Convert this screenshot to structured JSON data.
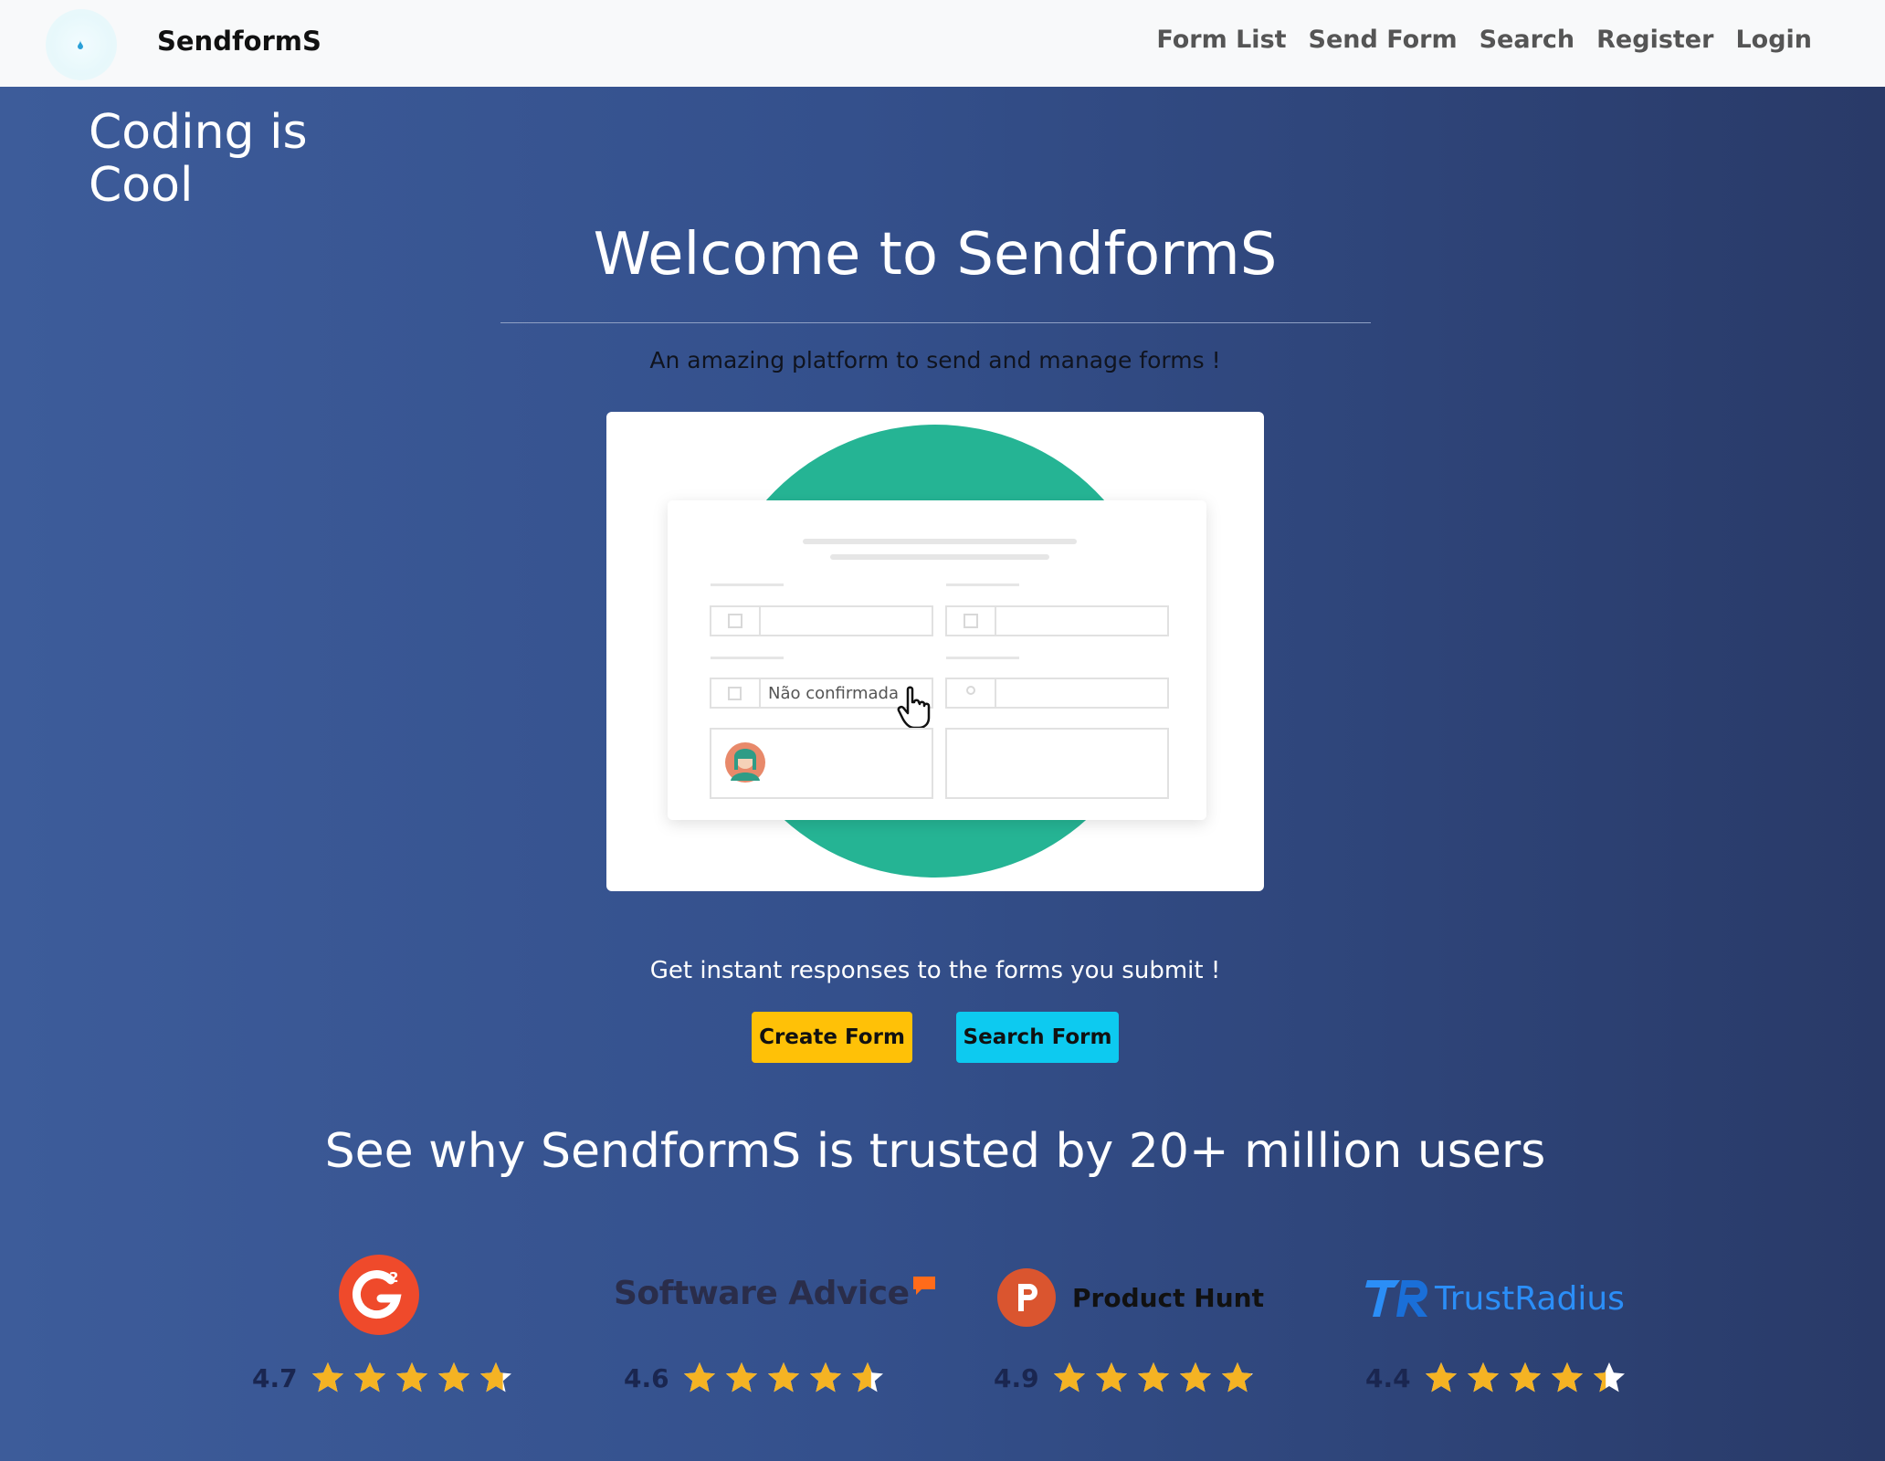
{
  "nav": {
    "brand": "SendformS",
    "links": [
      "Form List",
      "Send Form",
      "Search",
      "Register",
      "Login"
    ]
  },
  "hero": {
    "tagline": "Coding is Cool",
    "title": "Welcome to SendformS",
    "subtitle": "An amazing platform to send and manage forms !"
  },
  "illustration": {
    "field_text": "Não confirmada"
  },
  "cta": {
    "text": "Get instant responses to the forms you submit !",
    "create_label": "Create Form",
    "search_label": "Search Form"
  },
  "trusted": {
    "heading": "See why SendformS is trusted by 20+ million users"
  },
  "ratings": [
    {
      "platform": "G2",
      "logo_text": "G2",
      "score": "4.7",
      "stars": 4.7
    },
    {
      "platform": "Software Advice",
      "logo_text": "Software Advice",
      "score": "4.6",
      "stars": 4.6
    },
    {
      "platform": "Product Hunt",
      "logo_text": "Product Hunt",
      "score": "4.9",
      "stars": 4.9
    },
    {
      "platform": "TrustRadius",
      "logo_text": "TrustRadius",
      "score": "4.4",
      "stars": 4.4
    }
  ],
  "colors": {
    "star": "#f5b323",
    "create_button": "#ffc107",
    "search_button": "#0dcaf0",
    "illustration_circle": "#25b494"
  }
}
